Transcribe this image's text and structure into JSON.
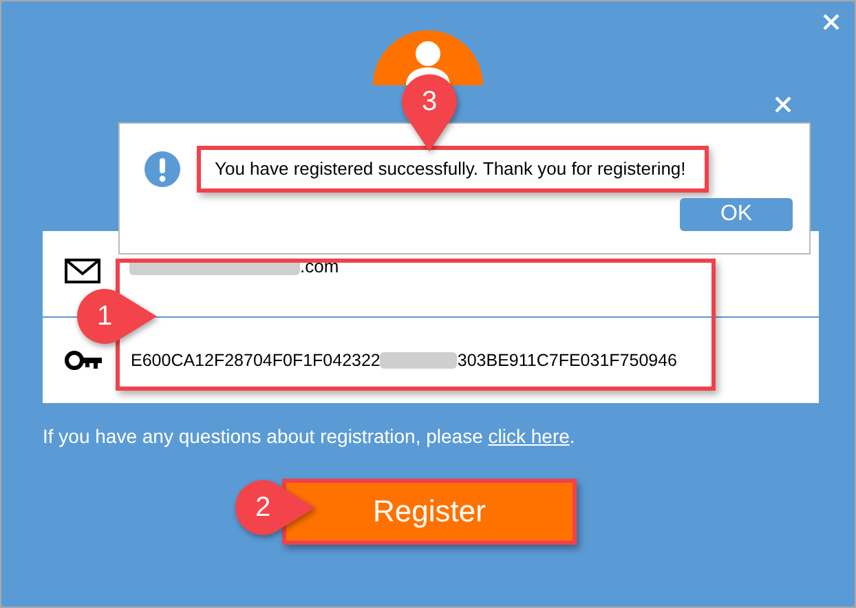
{
  "dialog": {
    "message": "You have registered successfully. Thank you for registering!",
    "ok_button": "OK"
  },
  "account": {
    "email_visible": ".com",
    "license_key_start": "E600CA12F28704F0F1F042322",
    "license_key_end": "303BE911C7FE031F750946"
  },
  "help": {
    "text": "If you have any questions about registration, please ",
    "link": "click here",
    "end": "."
  },
  "register_button": "Register",
  "annotations": [
    {
      "number": "1",
      "kind": "right"
    },
    {
      "number": "2",
      "kind": "right"
    },
    {
      "number": "3",
      "kind": "down"
    }
  ]
}
